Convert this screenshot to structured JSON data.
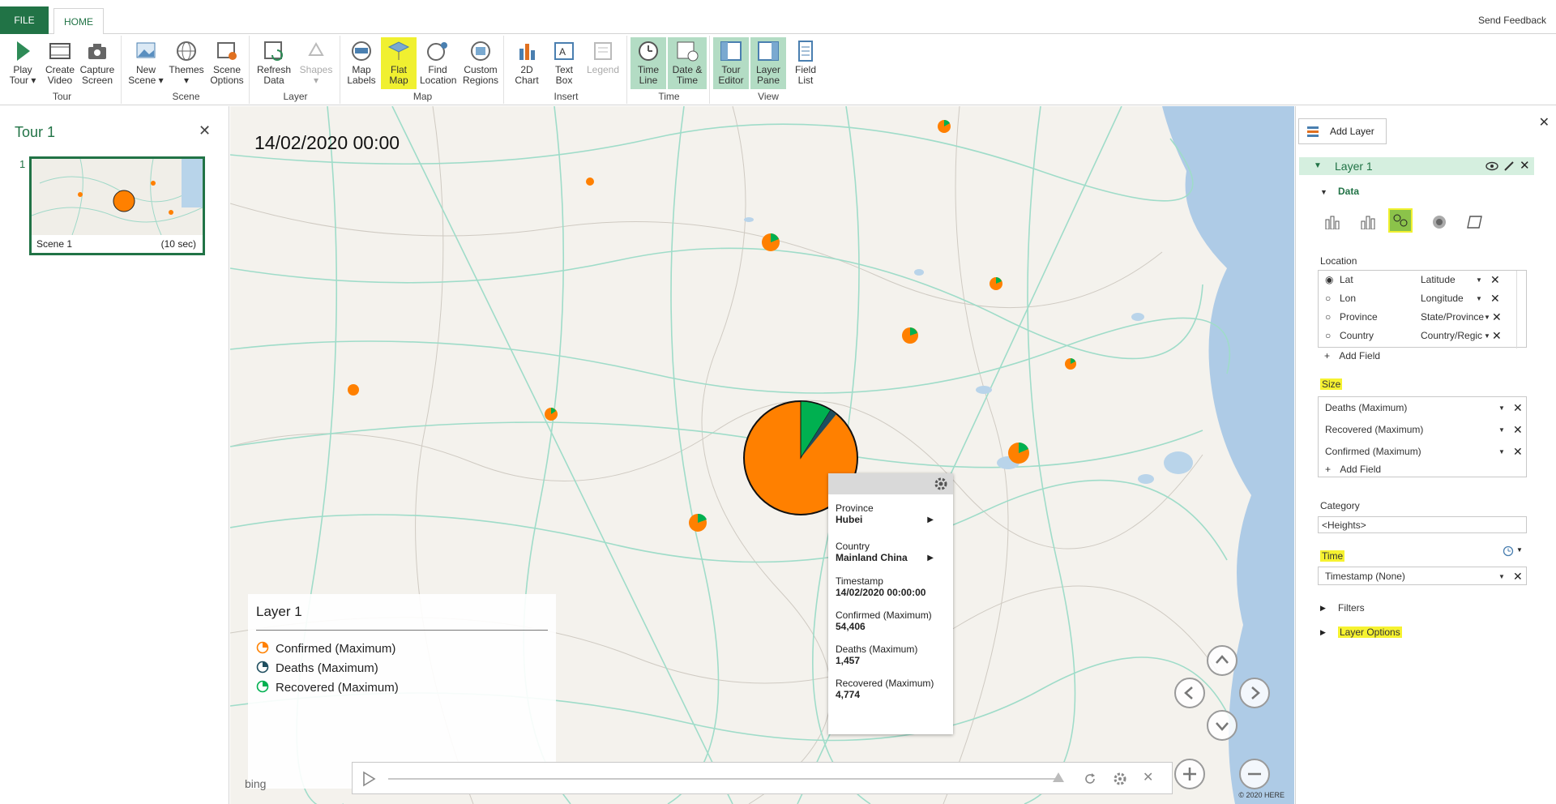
{
  "tabs": {
    "file": "FILE",
    "home": "HOME",
    "send_feedback": "Send Feedback"
  },
  "ribbon": {
    "groups": [
      {
        "label": "Tour",
        "buttons": [
          "Play Tour ▾",
          "Create Video",
          "Capture Screen"
        ]
      },
      {
        "label": "Scene",
        "buttons": [
          "New Scene ▾",
          "Themes ▾",
          "Scene Options"
        ]
      },
      {
        "label": "Layer",
        "buttons": [
          "Refresh Data",
          "Shapes ▾"
        ]
      },
      {
        "label": "Map",
        "buttons": [
          "Map Labels",
          "Flat Map",
          "Find Location",
          "Custom Regions"
        ]
      },
      {
        "label": "Insert",
        "buttons": [
          "2D Chart",
          "Text Box",
          "Legend"
        ]
      },
      {
        "label": "Time",
        "buttons": [
          "Time Line",
          "Date & Time"
        ]
      },
      {
        "label": "View",
        "buttons": [
          "Tour Editor",
          "Layer Pane",
          "Field List"
        ]
      }
    ]
  },
  "tour": {
    "title": "Tour 1",
    "scene_number": "1",
    "scene_name": "Scene 1",
    "scene_duration": "(10 sec)"
  },
  "map": {
    "timestamp": "14/02/2020 00:00",
    "legend": {
      "title": "Layer 1",
      "items": [
        "Confirmed (Maximum)",
        "Deaths (Maximum)",
        "Recovered (Maximum)"
      ]
    },
    "tooltip": {
      "province_label": "Province",
      "province_value": "Hubei",
      "country_label": "Country",
      "country_value": "Mainland China",
      "timestamp_label": "Timestamp",
      "timestamp_value": "14/02/2020 00:00:00",
      "confirmed_label": "Confirmed (Maximum)",
      "confirmed_value": "54,406",
      "deaths_label": "Deaths (Maximum)",
      "deaths_value": "1,457",
      "recovered_label": "Recovered (Maximum)",
      "recovered_value": "4,774"
    },
    "bing": "bing",
    "copyright": "© 2020 HERE",
    "colors": {
      "confirmed": "#ff8000",
      "deaths": "#1f4e5f",
      "recovered": "#00b050"
    }
  },
  "layer_pane": {
    "add_layer": "Add Layer",
    "layer_name": "Layer 1",
    "data_label": "Data",
    "location_label": "Location",
    "location_fields": [
      {
        "field": "Lat",
        "type": "Latitude"
      },
      {
        "field": "Lon",
        "type": "Longitude"
      },
      {
        "field": "Province",
        "type": "State/Province"
      },
      {
        "field": "Country",
        "type": "Country/Regic"
      }
    ],
    "add_field": "Add Field",
    "size_label": "Size",
    "size_fields": [
      "Deaths (Maximum)",
      "Recovered (Maximum)",
      "Confirmed (Maximum)"
    ],
    "category_label": "Category",
    "category_value": "<Heights>",
    "time_label": "Time",
    "time_value": "Timestamp (None)",
    "filters_label": "Filters",
    "layer_options_label": "Layer Options"
  }
}
